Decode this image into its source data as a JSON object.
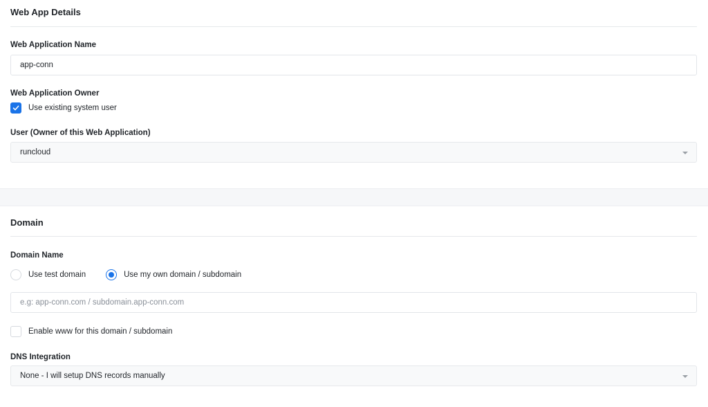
{
  "web_app_details": {
    "title": "Web App Details",
    "name_label": "Web Application Name",
    "name_value": "app-conn",
    "owner_label": "Web Application Owner",
    "use_existing_label": "Use existing system user",
    "use_existing_checked": true,
    "user_label": "User (Owner of this Web Application)",
    "user_value": "runcloud"
  },
  "domain": {
    "title": "Domain",
    "name_label": "Domain Name",
    "radio_options": [
      {
        "label": "Use test domain",
        "selected": false
      },
      {
        "label": "Use my own domain / subdomain",
        "selected": true
      }
    ],
    "domain_placeholder": "e.g: app-conn.com / subdomain.app-conn.com",
    "domain_value": "",
    "www_label": "Enable www for this domain / subdomain",
    "www_checked": false,
    "dns_label": "DNS Integration",
    "dns_value": "None - I will setup DNS records manually"
  },
  "colors": {
    "accent": "#1a73e8"
  }
}
